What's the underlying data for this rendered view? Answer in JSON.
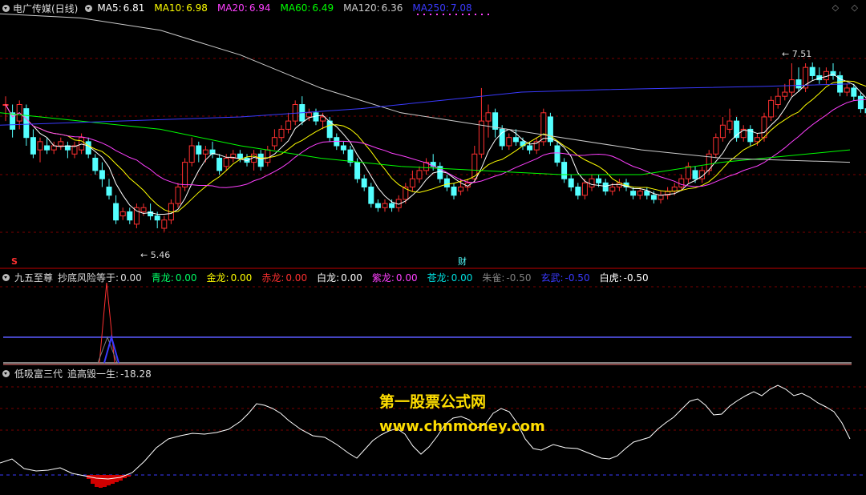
{
  "main_panel": {
    "title": "电广传媒(日线)",
    "indicators": [
      {
        "label": "MA5:",
        "value": "6.81",
        "color": "#ffffff"
      },
      {
        "label": "MA10:",
        "value": "6.98",
        "color": "#ffff00"
      },
      {
        "label": "MA20:",
        "value": "6.94",
        "color": "#ff40ff"
      },
      {
        "label": "MA60:",
        "value": "6.49",
        "color": "#00ff00"
      },
      {
        "label": "MA120:",
        "value": "6.36",
        "color": "#cccccc"
      },
      {
        "label": "MA250:",
        "value": "7.08",
        "color": "#3a3aff"
      }
    ],
    "high_label": "7.51",
    "low_label": "5.46",
    "marker_s": "S",
    "marker_cai": "财",
    "corner": "◇ ◇"
  },
  "panel2": {
    "title": "九五至尊",
    "items": [
      {
        "label": "抄底风险等于:",
        "value": "0.00",
        "color": "#dddddd"
      },
      {
        "label": "青龙:",
        "value": "0.00",
        "color": "#00ff66"
      },
      {
        "label": "金龙:",
        "value": "0.00",
        "color": "#ffff00"
      },
      {
        "label": "赤龙:",
        "value": "0.00",
        "color": "#ff3030"
      },
      {
        "label": "白龙:",
        "value": "0.00",
        "color": "#ffffff"
      },
      {
        "label": "紫龙:",
        "value": "0.00",
        "color": "#ff40ff"
      },
      {
        "label": "苍龙:",
        "value": "0.00",
        "color": "#00e0e0"
      },
      {
        "label": "朱雀:",
        "value": "-0.50",
        "color": "#808080"
      },
      {
        "label": "玄武:",
        "value": "-0.50",
        "color": "#3a3aff"
      },
      {
        "label": "白虎:",
        "value": "-0.50",
        "color": "#ffffff"
      }
    ]
  },
  "panel3": {
    "title": "低吸富三代",
    "items": [
      {
        "label": "追高毁一生:",
        "value": "-18.28",
        "color": "#dddddd"
      }
    ]
  },
  "watermark": {
    "line1": "第一股票公式网",
    "line2": "www.chnmoney.com"
  },
  "colors": {
    "up": "#ff3030",
    "down": "#54ffff",
    "grid": "#7a0000"
  }
}
